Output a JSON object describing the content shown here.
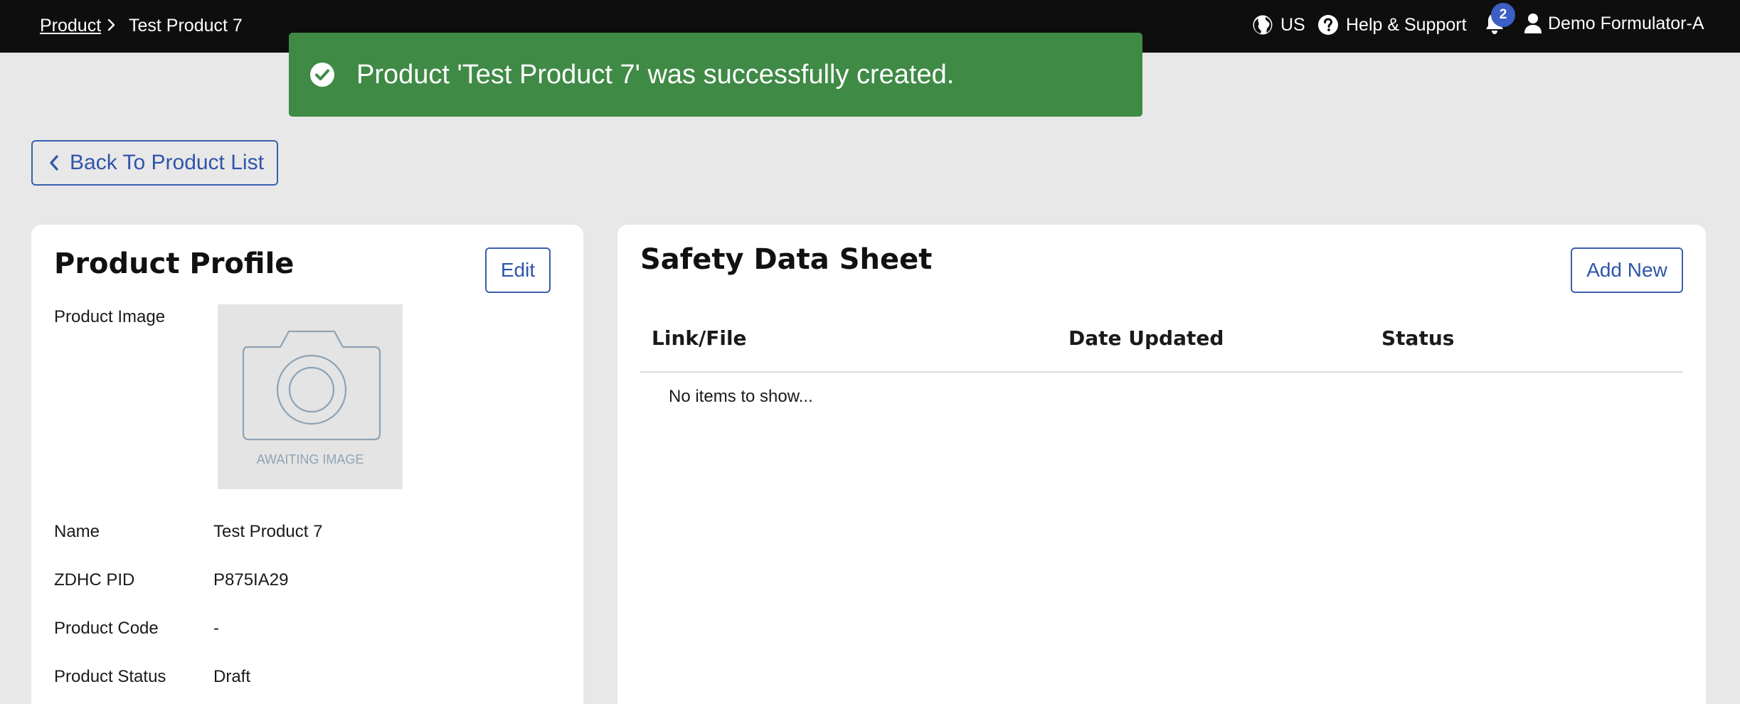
{
  "breadcrumb": {
    "parent": "Product",
    "separator": ">",
    "current": "Test Product 7"
  },
  "header": {
    "region": "US",
    "help": "Help & Support",
    "notification_count": "2",
    "user": "Demo Formulator-A"
  },
  "toast": {
    "message": "Product 'Test Product 7' was successfully created."
  },
  "back_button": {
    "label": "Back To Product List"
  },
  "profile": {
    "title": "Product Profile",
    "edit_label": "Edit",
    "image_label": "Product Image",
    "image_placeholder": "AWAITING IMAGE",
    "fields": [
      {
        "label": "Name",
        "value": "Test Product 7"
      },
      {
        "label": "ZDHC PID",
        "value": "P875IA29"
      },
      {
        "label": "Product Code",
        "value": "-"
      },
      {
        "label": "Product Status",
        "value": "Draft"
      }
    ]
  },
  "sds": {
    "title": "Safety Data Sheet",
    "add_label": "Add New",
    "columns": [
      "Link/File",
      "Date Updated",
      "Status"
    ],
    "empty": "No items to show..."
  }
}
